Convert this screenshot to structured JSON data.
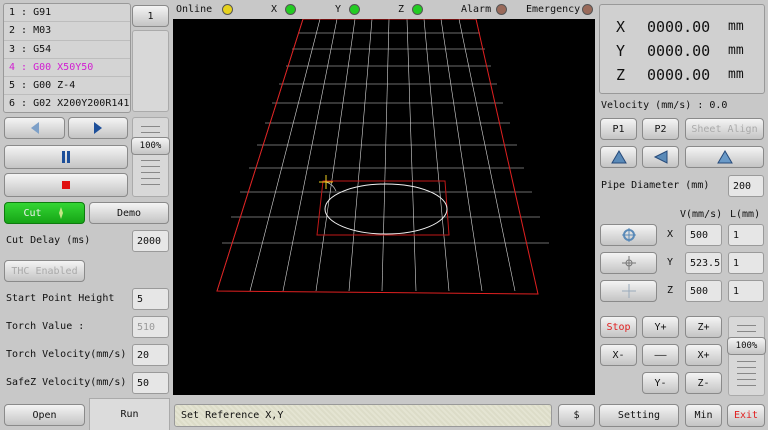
{
  "program_lines": [
    "1 : G91",
    "2 : M03",
    "3 : G54",
    "4 : G00 X50Y50",
    "5 : G00 Z-4",
    "6 : G02 X200Y200R141"
  ],
  "current_line_label": "1",
  "speed_percent": "100%",
  "cut_label": "Cut",
  "demo_label": "Demo",
  "cut_delay_label": "Cut Delay (ms)",
  "cut_delay_value": "2000",
  "thc_label": "THC Enabled",
  "start_height_label": "Start Point Height",
  "start_height_value": "5",
  "torch_value_label": "Torch Value :",
  "torch_value": "510",
  "torch_velocity_label": "Torch Velocity(mm/s)",
  "torch_velocity_value": "20",
  "safez_label": "SafeZ Velocity(mm/s)",
  "safez_value": "50",
  "open_label": "Open",
  "run_label": "Run",
  "status_bar": {
    "online": "Online",
    "x": "X",
    "y": "Y",
    "z": "Z",
    "alarm": "Alarm",
    "emergency": "Emergency"
  },
  "status_colors": {
    "online": "#e6d21e",
    "axis": "#22cc22",
    "alarm": "#9a6a5a"
  },
  "message": "Set Reference X,Y",
  "dollar_label": "$",
  "setting_label": "Setting",
  "min_label": "Min",
  "exit_label": "Exit",
  "coords": {
    "x_label": "X",
    "x_value": "0000.00",
    "y_label": "Y",
    "y_value": "0000.00",
    "z_label": "Z",
    "z_value": "0000.00",
    "unit": "mm"
  },
  "velocity_label": "Velocity (mm/s) : 0.0",
  "p1_label": "P1",
  "p2_label": "P2",
  "sheet_align_label": "Sheet Align",
  "pipe_diameter_label": "Pipe Diameter (mm)",
  "pipe_diameter_value": "200",
  "v_header": "V(mm/s)",
  "l_header": "L(mm)",
  "axis_rows": [
    {
      "axis": "X",
      "v": "500",
      "l": "1"
    },
    {
      "axis": "Y",
      "v": "523.5",
      "l": "1"
    },
    {
      "axis": "Z",
      "v": "500",
      "l": "1"
    }
  ],
  "jog": {
    "stop": "Stop",
    "yp": "Y+",
    "zp": "Z+",
    "xm": "X-",
    "mid": "——",
    "xp": "X+",
    "ym": "Y-",
    "zm": "Z-"
  },
  "jog_speed_percent": "100%"
}
